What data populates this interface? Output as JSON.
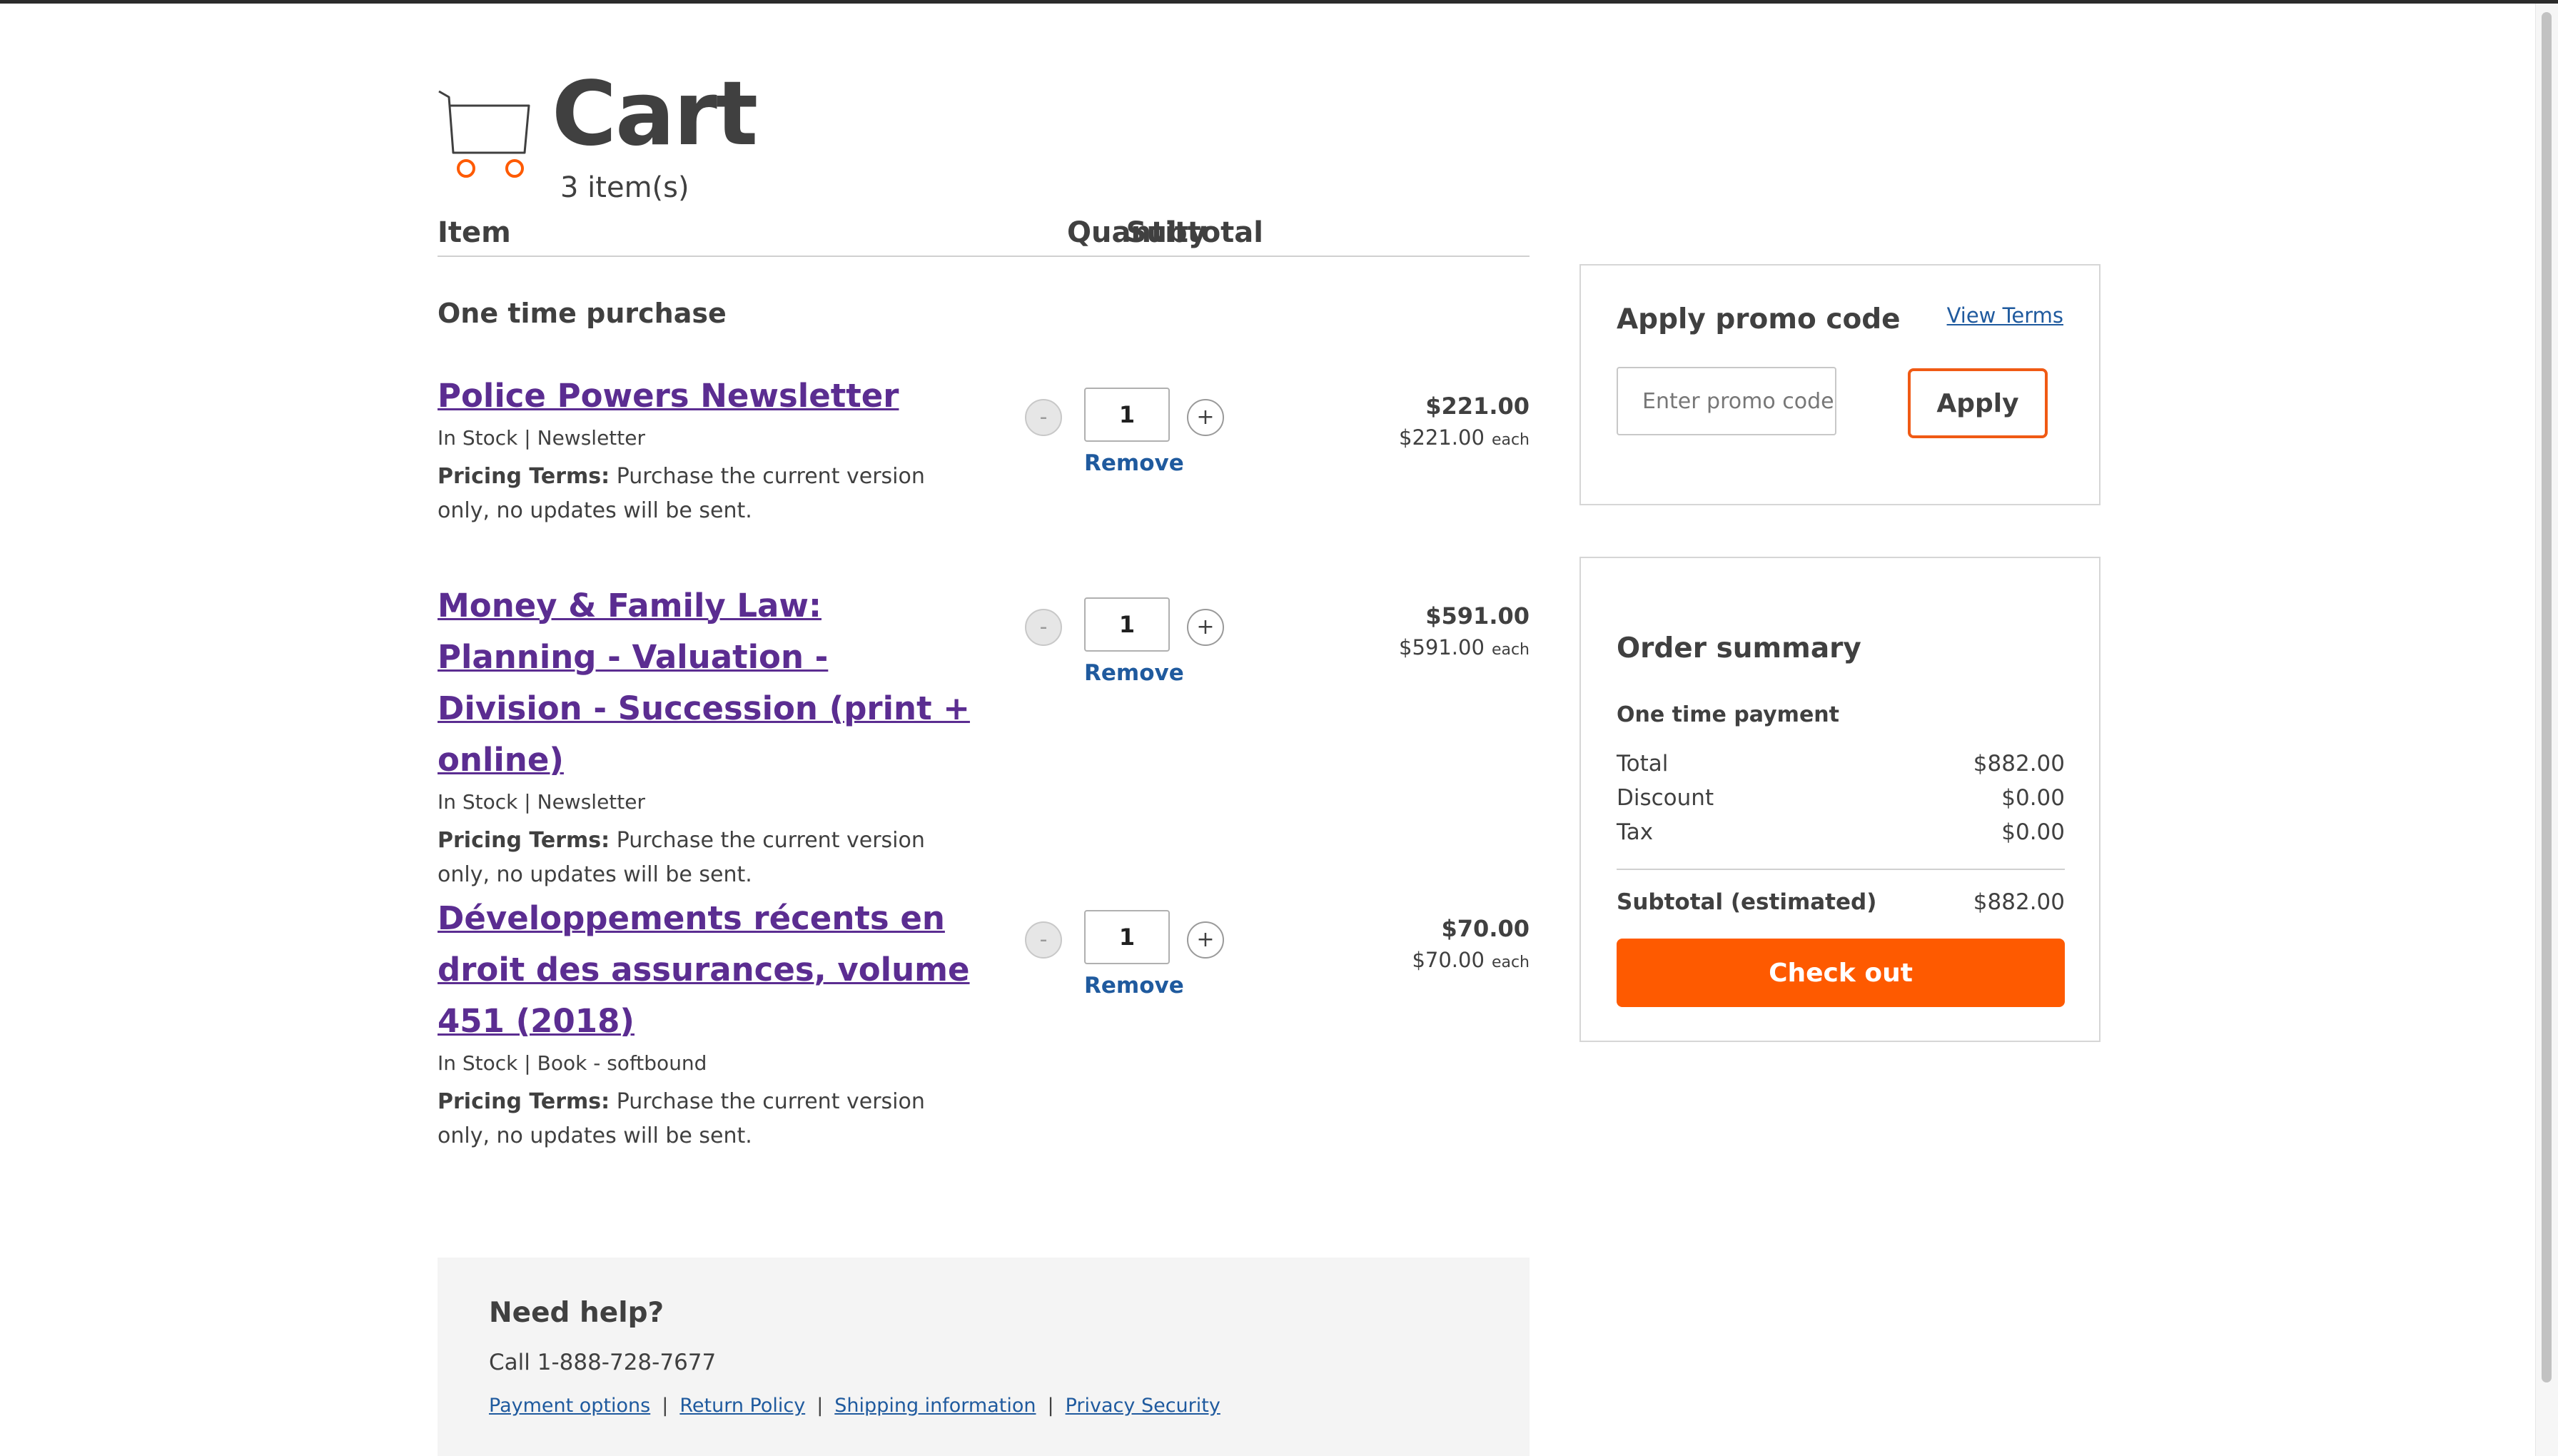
{
  "header": {
    "title": "Cart",
    "item_count": "3 item(s)"
  },
  "columns": {
    "item": "Item",
    "quantity": "Quantity",
    "subtotal": "Subtotal"
  },
  "section_label": "One time purchase",
  "items": [
    {
      "title": "Police Powers Newsletter",
      "meta": "In Stock | Newsletter",
      "terms_label": "Pricing Terms:",
      "terms_text": "Purchase the current version only, no updates will be sent.",
      "quantity": "1",
      "minus": "-",
      "plus": "+",
      "remove": "Remove",
      "total": "$221.00",
      "each_price": "$221.00",
      "each_word": "each"
    },
    {
      "title": "Money & Family Law: Planning - Valuation - Division - Succession (print + online)",
      "meta": "In Stock | Newsletter",
      "terms_label": "Pricing Terms:",
      "terms_text": "Purchase the current version only, no updates will be sent.",
      "quantity": "1",
      "minus": "-",
      "plus": "+",
      "remove": "Remove",
      "total": "$591.00",
      "each_price": "$591.00",
      "each_word": "each"
    },
    {
      "title": "Développements récents en droit des assurances, volume 451 (2018)",
      "meta": "In Stock | Book - softbound",
      "terms_label": "Pricing Terms:",
      "terms_text": "Purchase the current version only, no updates will be sent.",
      "quantity": "1",
      "minus": "-",
      "plus": "+",
      "remove": "Remove",
      "total": "$70.00",
      "each_price": "$70.00",
      "each_word": "each"
    }
  ],
  "promo": {
    "title": "Apply promo code",
    "view_terms": "View Terms",
    "placeholder": "Enter promo code",
    "apply": "Apply"
  },
  "summary": {
    "title": "Order summary",
    "subtitle": "One time payment",
    "rows": [
      {
        "label": "Total",
        "value": "$882.00"
      },
      {
        "label": "Discount",
        "value": "$0.00"
      },
      {
        "label": "Tax",
        "value": "$0.00"
      }
    ],
    "subtotal_label": "Subtotal (estimated)",
    "subtotal_value": "$882.00",
    "checkout": "Check out"
  },
  "help": {
    "title": "Need help?",
    "phone": "Call 1-888-728-7677",
    "links": [
      "Payment options",
      "Return Policy",
      "Shipping information",
      "Privacy Security"
    ],
    "separator": "|"
  },
  "colors": {
    "accent": "#fe5a00",
    "link_visited": "#5b2d91",
    "link": "#1f5a9e",
    "text": "#404040"
  },
  "icons": {
    "cart": "shopping-cart-icon"
  }
}
